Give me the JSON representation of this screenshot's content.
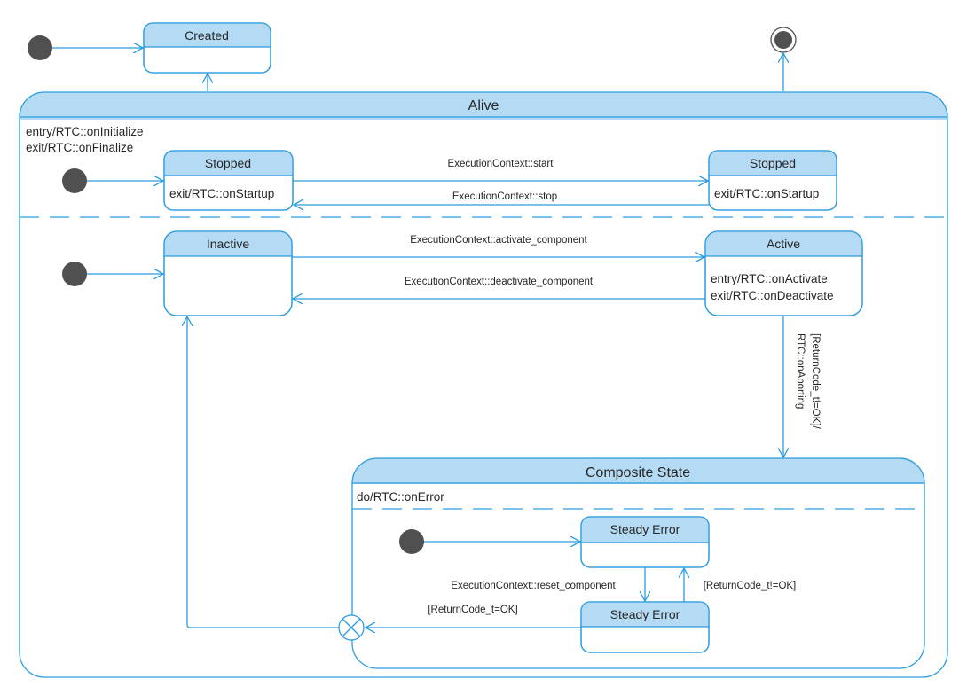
{
  "diagram": {
    "type": "UML state machine",
    "colors": {
      "line": "#2b9ce0",
      "header_fill": "#b5daf3",
      "pseudostate": "#505050"
    },
    "states": {
      "created": {
        "title": "Created"
      },
      "alive": {
        "title": "Alive",
        "entry": "entry/RTC::onInitialize",
        "exit": "exit/RTC::onFinalize"
      },
      "stopped_left": {
        "title": "Stopped",
        "body": "exit/RTC::onStartup"
      },
      "stopped_right": {
        "title": "Stopped",
        "body": "exit/RTC::onStartup"
      },
      "inactive": {
        "title": "Inactive"
      },
      "active": {
        "title": "Active",
        "entry": "entry/RTC::onActivate",
        "exit": "exit/RTC::onDeactivate"
      },
      "composite": {
        "title": "Composite State",
        "do": "do/RTC::onError"
      },
      "steady_error_top": {
        "title": "Steady Error"
      },
      "steady_error_bottom": {
        "title": "Steady Error"
      }
    },
    "transitions": {
      "start": "ExecutionContext::start",
      "stop": "ExecutionContext::stop",
      "activate": "ExecutionContext::activate_component",
      "deactivate": "ExecutionContext::deactivate_component",
      "aborting_line1": "[ReturnCode_t!=OK]/",
      "aborting_line2": "RTC::onAborting",
      "reset": "ExecutionContext::reset_component",
      "not_ok": "[ReturnCode_t!=OK]",
      "ok": "[ReturnCode_t=OK]"
    }
  }
}
